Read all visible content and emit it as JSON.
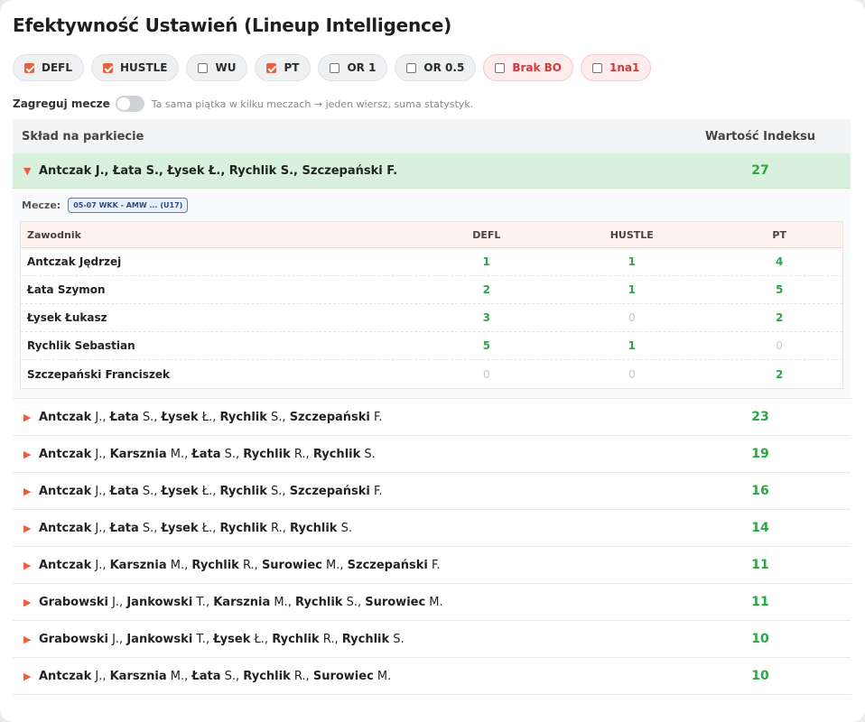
{
  "title": "Efektywność Ustawień (Lineup Intelligence)",
  "filters": [
    {
      "label": "DEFL",
      "checked": true,
      "style": "normal"
    },
    {
      "label": "HUSTLE",
      "checked": true,
      "style": "normal"
    },
    {
      "label": "WU",
      "checked": false,
      "style": "normal"
    },
    {
      "label": "PT",
      "checked": true,
      "style": "normal"
    },
    {
      "label": "OR 1",
      "checked": false,
      "style": "normal"
    },
    {
      "label": "OR 0.5",
      "checked": false,
      "style": "normal"
    },
    {
      "label": "Brak BO",
      "checked": false,
      "style": "red"
    },
    {
      "label": "1na1",
      "checked": false,
      "style": "red"
    }
  ],
  "aggregate": {
    "label": "Zagreguj mecze",
    "enabled": false,
    "hint": "Ta sama piątka w kilku meczach → jeden wiersz, suma statystyk."
  },
  "table": {
    "col_lineup": "Skład na parkiecie",
    "col_value": "Wartość Indeksu",
    "expanded": {
      "lineup": "Antczak J., Łata S., Łysek Ł., Rychlik S., Szczepański F.",
      "value": "27",
      "matches_label": "Mecze:",
      "match_badge": "05-07 WKK - AMW ... (U17)",
      "sub_headers": [
        "Zawodnik",
        "DEFL",
        "HUSTLE",
        "PT"
      ],
      "players": [
        {
          "name": "Antczak Jędrzej",
          "defl": "1",
          "hustle": "1",
          "pt": "4"
        },
        {
          "name": "Łata Szymon",
          "defl": "2",
          "hustle": "1",
          "pt": "5"
        },
        {
          "name": "Łysek Łukasz",
          "defl": "3",
          "hustle": "0",
          "pt": "2"
        },
        {
          "name": "Rychlik Sebastian",
          "defl": "5",
          "hustle": "1",
          "pt": "0"
        },
        {
          "name": "Szczepański Franciszek",
          "defl": "0",
          "hustle": "0",
          "pt": "2"
        }
      ]
    },
    "rows": [
      {
        "lineup": [
          [
            "Antczak",
            "J."
          ],
          [
            "Łata",
            "S."
          ],
          [
            "Łysek",
            "Ł."
          ],
          [
            "Rychlik",
            "S."
          ],
          [
            "Szczepański",
            "F."
          ]
        ],
        "value": "23"
      },
      {
        "lineup": [
          [
            "Antczak",
            "J."
          ],
          [
            "Karsznia",
            "M."
          ],
          [
            "Łata",
            "S."
          ],
          [
            "Rychlik",
            "R."
          ],
          [
            "Rychlik",
            "S."
          ]
        ],
        "value": "19"
      },
      {
        "lineup": [
          [
            "Antczak",
            "J."
          ],
          [
            "Łata",
            "S."
          ],
          [
            "Łysek",
            "Ł."
          ],
          [
            "Rychlik",
            "S."
          ],
          [
            "Szczepański",
            "F."
          ]
        ],
        "value": "16"
      },
      {
        "lineup": [
          [
            "Antczak",
            "J."
          ],
          [
            "Łata",
            "S."
          ],
          [
            "Łysek",
            "Ł."
          ],
          [
            "Rychlik",
            "R."
          ],
          [
            "Rychlik",
            "S."
          ]
        ],
        "value": "14"
      },
      {
        "lineup": [
          [
            "Antczak",
            "J."
          ],
          [
            "Karsznia",
            "M."
          ],
          [
            "Rychlik",
            "R."
          ],
          [
            "Surowiec",
            "M."
          ],
          [
            "Szczepański",
            "F."
          ]
        ],
        "value": "11"
      },
      {
        "lineup": [
          [
            "Grabowski",
            "J."
          ],
          [
            "Jankowski",
            "T."
          ],
          [
            "Karsznia",
            "M."
          ],
          [
            "Rychlik",
            "S."
          ],
          [
            "Surowiec",
            "M."
          ]
        ],
        "value": "11"
      },
      {
        "lineup": [
          [
            "Grabowski",
            "J."
          ],
          [
            "Jankowski",
            "T."
          ],
          [
            "Łysek",
            "Ł."
          ],
          [
            "Rychlik",
            "R."
          ],
          [
            "Rychlik",
            "S."
          ]
        ],
        "value": "10"
      },
      {
        "lineup": [
          [
            "Antczak",
            "J."
          ],
          [
            "Karsznia",
            "M."
          ],
          [
            "Łata",
            "S."
          ],
          [
            "Rychlik",
            "R."
          ],
          [
            "Surowiec",
            "M."
          ]
        ],
        "value": "10"
      }
    ]
  },
  "colors": {
    "accent": "#e8603c",
    "positive": "#2aa745",
    "expanded_row": "#d9f1dc"
  }
}
